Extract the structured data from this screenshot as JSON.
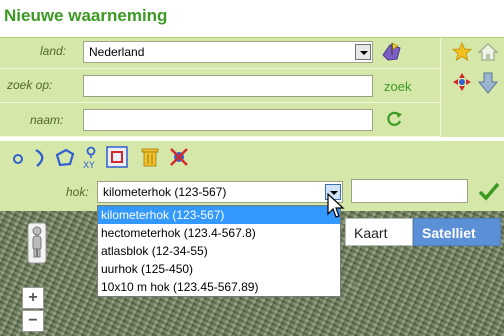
{
  "page_title": "Nieuwe waarneming",
  "form": {
    "land_label": "land:",
    "land_value": "Nederland",
    "zoek_label": "zoek op:",
    "zoek_value": "",
    "zoek_link": "zoek",
    "naam_label": "naam:",
    "naam_value": "",
    "hok_label": "hok:",
    "hok_value": "kilometerhok (123-567)",
    "hok_extra_value": ""
  },
  "hok_options": [
    {
      "label": "kilometerhok (123-567)",
      "selected": true
    },
    {
      "label": "hectometerhok (123.4-567.8)",
      "selected": false
    },
    {
      "label": "atlasblok (12-34-55)",
      "selected": false
    },
    {
      "label": "uurhok (125-450)",
      "selected": false
    },
    {
      "label": "10x10 m hok (123.45-567.89)",
      "selected": false
    }
  ],
  "map": {
    "kaart_label": "Kaart",
    "satelliet_label": "Satelliet",
    "zoom_in": "+",
    "zoom_out": "−"
  },
  "colors": {
    "title": "#3c9a23",
    "panel": "#d6e8a9",
    "selected": "#3399ff",
    "satelliet_active": "#5b8fd6"
  },
  "icons": {
    "tools": [
      "point-tool-icon",
      "line-tool-icon",
      "polygon-tool-icon",
      "xy-coordinate-icon",
      "square-tool-icon",
      "trash-icon",
      "delete-marker-icon"
    ],
    "side": [
      "star-icon",
      "home-icon",
      "crosshair-icon",
      "down-arrow-icon",
      "map-flag-icon",
      "refresh-icon",
      "checkmark-icon",
      "pegman-icon"
    ]
  }
}
